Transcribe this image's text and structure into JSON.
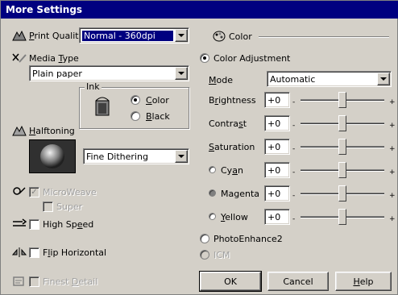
{
  "window": {
    "title": "More Settings"
  },
  "left": {
    "print_quality": {
      "label": "Print Quality",
      "value": "Normal - 360dpi"
    },
    "media_type": {
      "label": "Media Type",
      "value": "Plain paper"
    },
    "ink": {
      "label": "Ink",
      "options": [
        "Color",
        "Black"
      ],
      "selected": "Color"
    },
    "halftoning": {
      "label": "Halftoning",
      "value": "Fine Dithering"
    },
    "microweave": {
      "label": "MicroWeave",
      "checked": true,
      "enabled": false
    },
    "super": {
      "label": "Super",
      "checked": false,
      "enabled": false
    },
    "high_speed": {
      "label": "High Speed",
      "checked": false,
      "enabled": true
    },
    "flip_horizontal": {
      "label": "Flip Horizontal",
      "checked": false,
      "enabled": true
    },
    "finest_detail": {
      "label": "Finest Detail",
      "checked": false,
      "enabled": false
    }
  },
  "right": {
    "color_group": {
      "label": "Color"
    },
    "color_adjustment": {
      "label": "Color Adjustment",
      "selected": true
    },
    "mode": {
      "label": "Mode",
      "value": "Automatic"
    },
    "sliders": [
      {
        "label": "Brightness",
        "value": "+0",
        "level": 0.5
      },
      {
        "label": "Contrast",
        "value": "+0",
        "level": 0.5
      },
      {
        "label": "Saturation",
        "value": "+0",
        "level": 0.5
      },
      {
        "label": "Cyan",
        "value": "+0",
        "level": 0.5,
        "color_radio": true
      },
      {
        "label": "Magenta",
        "value": "+0",
        "level": 0.5,
        "color_radio": true
      },
      {
        "label": "Yellow",
        "value": "+0",
        "level": 0.5,
        "color_radio": true
      }
    ],
    "minus_sign": "-",
    "plus_sign": "+",
    "photo_enhance": {
      "label": "PhotoEnhance2",
      "selected": false
    },
    "icm": {
      "label": "ICM",
      "enabled": false
    }
  },
  "buttons": {
    "ok": "OK",
    "cancel": "Cancel",
    "help": "Help"
  }
}
